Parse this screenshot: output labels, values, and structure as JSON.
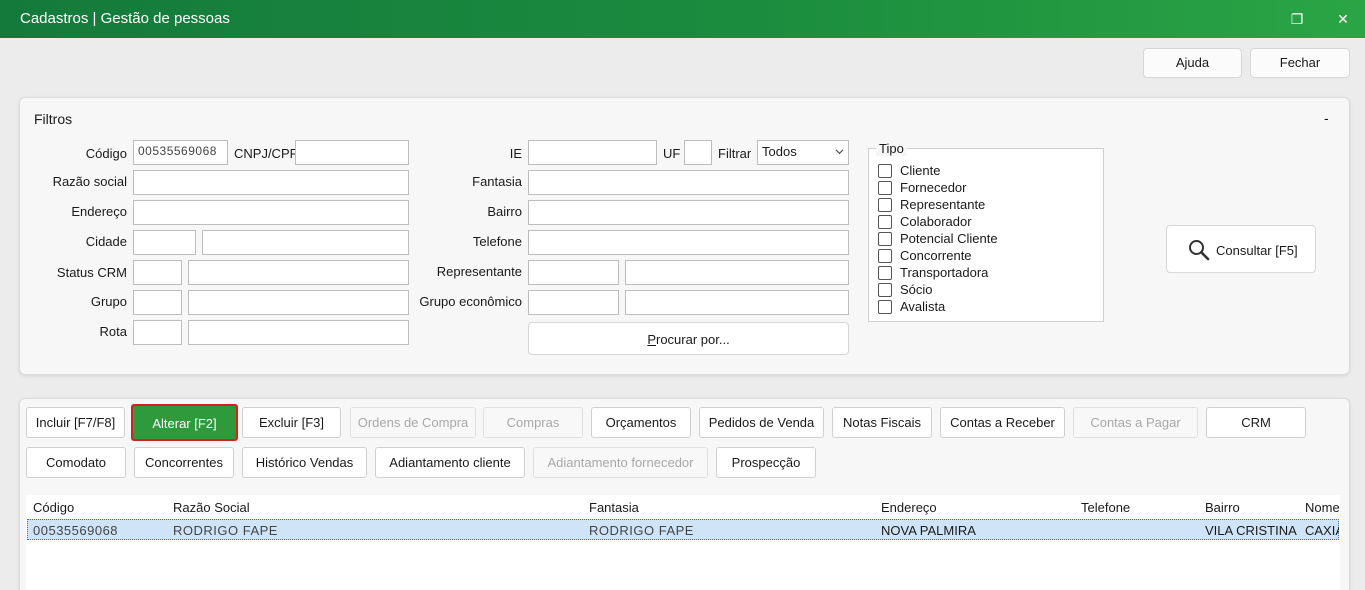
{
  "window": {
    "title": "Cadastros | Gestão de pessoas",
    "restore_glyph": "❐",
    "close_glyph": "✕"
  },
  "top_buttons": {
    "help": "Ajuda",
    "close": "Fechar"
  },
  "filters": {
    "title": "Filtros",
    "collapse": "-",
    "labels": {
      "codigo": "Código",
      "cnpj": "CNPJ/CPF",
      "razao": "Razão social",
      "endereco": "Endereço",
      "cidade": "Cidade",
      "status_crm": "Status CRM",
      "grupo": "Grupo",
      "rota": "Rota",
      "ie": "IE",
      "uf": "UF",
      "filtrar": "Filtrar",
      "fantasia": "Fantasia",
      "bairro": "Bairro",
      "telefone": "Telefone",
      "representante": "Representante",
      "grupo_economico": "Grupo econômico"
    },
    "values": {
      "codigo": "00535569068",
      "filtrar": "Todos"
    },
    "procurar": "Procurar por...",
    "procurar_underline": "P",
    "procurar_rest": "rocurar por..."
  },
  "tipo": {
    "legend": "Tipo",
    "options": [
      "Cliente",
      "Fornecedor",
      "Representante",
      "Colaborador",
      "Potencial Cliente",
      "Concorrente",
      "Transportadora",
      "Sócio",
      "Avalista"
    ]
  },
  "consultar": {
    "label": "Consultar [F5]",
    "icon": "search-icon"
  },
  "actions": {
    "incluir": "Incluir [F7/F8]",
    "alterar": "Alterar [F2]",
    "excluir": "Excluir [F3]",
    "ordens_compra": "Ordens de Compra",
    "compras": "Compras",
    "orcamentos": "Orçamentos",
    "pedidos_venda": "Pedidos de Venda",
    "notas_fiscais": "Notas Fiscais",
    "contas_receber": "Contas a Receber",
    "contas_pagar": "Contas a Pagar",
    "crm": "CRM",
    "comodato": "Comodato",
    "concorrentes": "Concorrentes",
    "historico_vendas": "Histórico Vendas",
    "adiantamento_cliente": "Adiantamento cliente",
    "adiantamento_fornecedor": "Adiantamento fornecedor",
    "prospeccao": "Prospecção"
  },
  "grid": {
    "columns": [
      "Código",
      "Razão Social",
      "Fantasia",
      "Endereço",
      "Telefone",
      "Bairro",
      "Nome"
    ],
    "rows": [
      [
        "00535569068",
        "RODRIGO FAPE",
        "RODRIGO FAPE",
        "NOVA PALMIRA",
        "",
        "VILA CRISTINA",
        "CAXIA"
      ]
    ]
  },
  "colors": {
    "title_bar": "#1b8c3e",
    "active_button": "#2e9a3c",
    "highlight_border": "#d81e1e",
    "row_selected": "#cfe4f7"
  }
}
